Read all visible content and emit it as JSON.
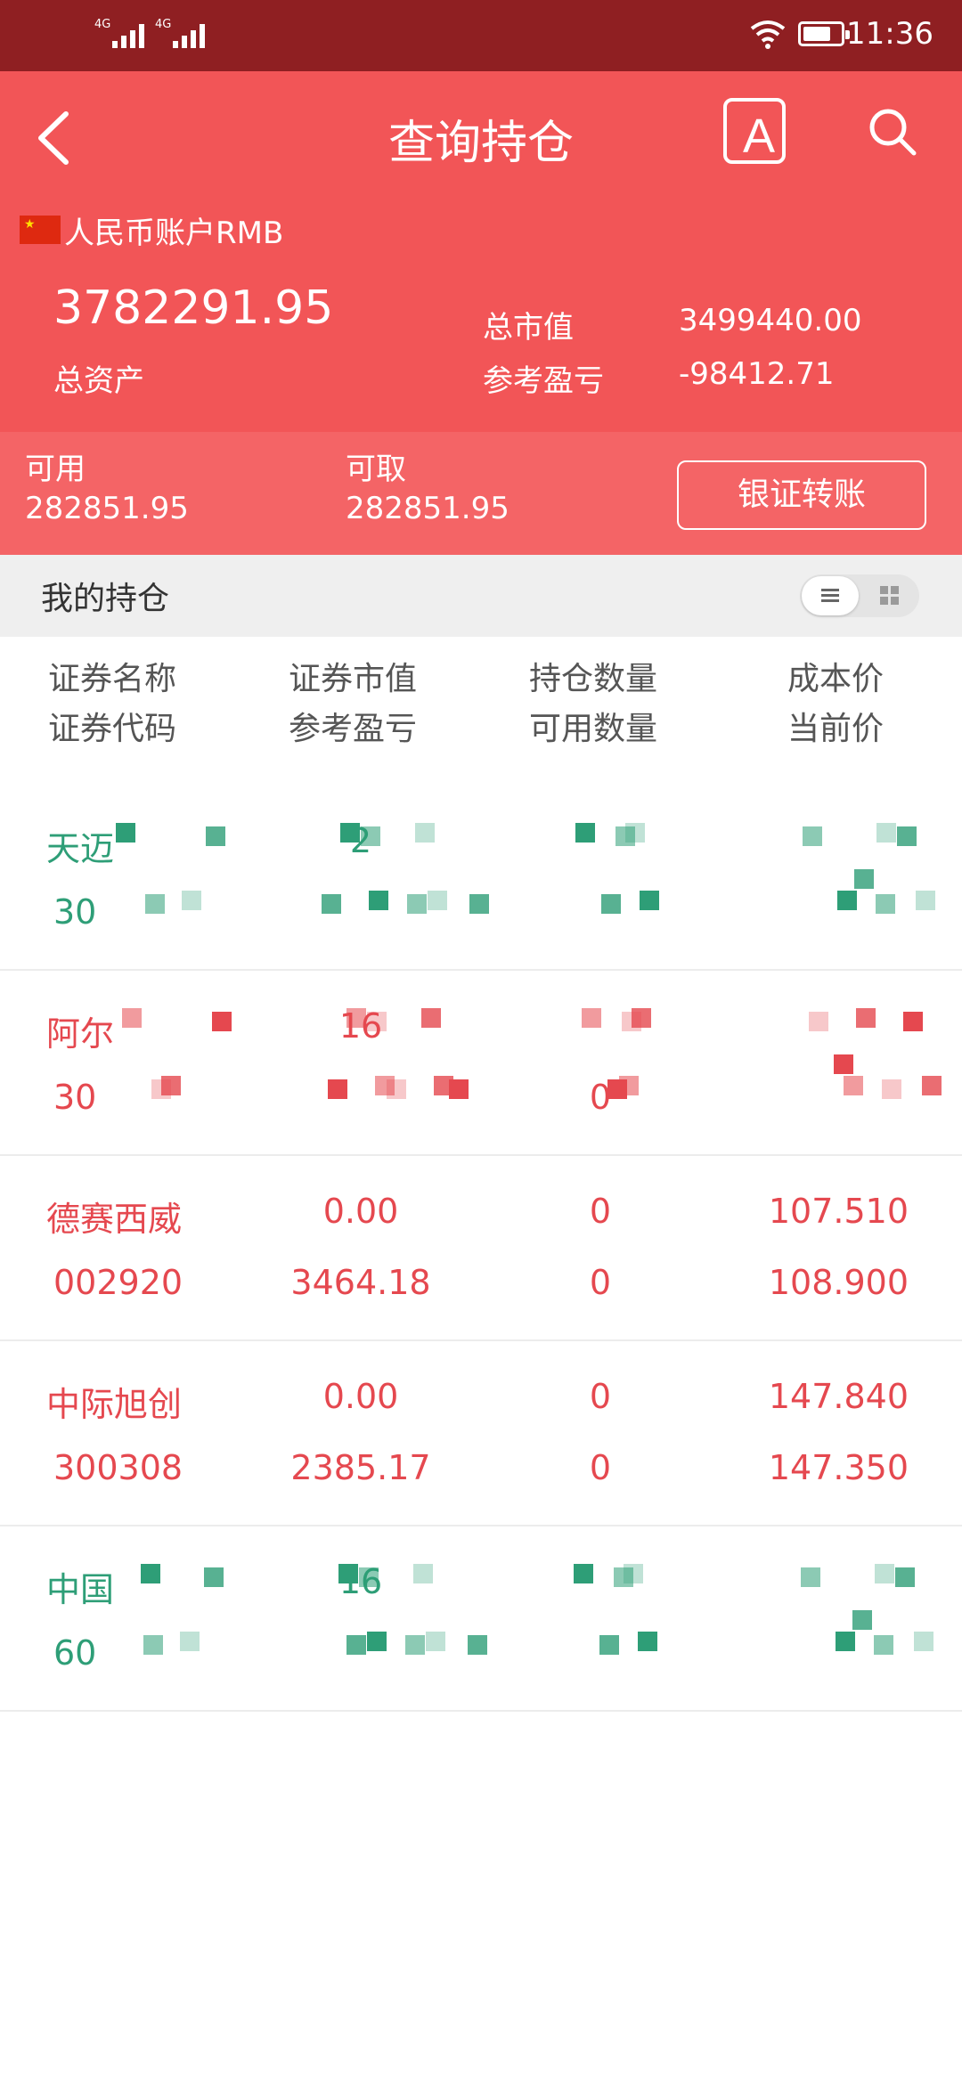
{
  "status_bar": {
    "network_1": "4G",
    "network_2": "4G",
    "time": "11:36"
  },
  "header": {
    "title": "查询持仓",
    "font_button": "A"
  },
  "account": {
    "name": "人民币账户RMB",
    "total_assets_value": "3782291.95",
    "total_assets_label": "总资产",
    "market_value_label": "总市值",
    "market_value": "3499440.00",
    "pnl_label": "参考盈亏",
    "pnl": "-98412.71"
  },
  "available": {
    "usable_label": "可用",
    "usable_value": "282851.95",
    "withdrawable_label": "可取",
    "withdrawable_value": "282851.95",
    "transfer_button": "银证转账"
  },
  "holdings_bar": {
    "label": "我的持仓"
  },
  "columns": [
    {
      "line1": "证券名称",
      "line2": "证券代码"
    },
    {
      "line1": "证券市值",
      "line2": "参考盈亏"
    },
    {
      "line1": "持仓数量",
      "line2": "可用数量"
    },
    {
      "line1": "成本价",
      "line2": "当前价"
    }
  ],
  "rows": [
    {
      "name": "天迈",
      "code": "30",
      "market_value": "2",
      "pnl": "",
      "position": "",
      "available": "",
      "cost": "",
      "price": "",
      "color": "#2e9e77",
      "obscured": true
    },
    {
      "name": "阿尔",
      "code": "30",
      "market_value": "16",
      "pnl": "",
      "position": "",
      "available": "0",
      "cost": "",
      "price": "",
      "color": "#e5484f",
      "obscured": true
    },
    {
      "name": "德赛西威",
      "code": "002920",
      "market_value": "0.00",
      "pnl": "3464.18",
      "position": "0",
      "available": "0",
      "cost": "107.510",
      "price": "108.900",
      "color": "#e5484f",
      "obscured": false
    },
    {
      "name": "中际旭创",
      "code": "300308",
      "market_value": "0.00",
      "pnl": "2385.17",
      "position": "0",
      "available": "0",
      "cost": "147.840",
      "price": "147.350",
      "color": "#e5484f",
      "obscured": false
    },
    {
      "name": "中国",
      "code": "60",
      "market_value": "16",
      "pnl": "",
      "position": "",
      "available": "",
      "cost": "",
      "price": "",
      "color": "#2e9e77",
      "obscured": true
    }
  ]
}
